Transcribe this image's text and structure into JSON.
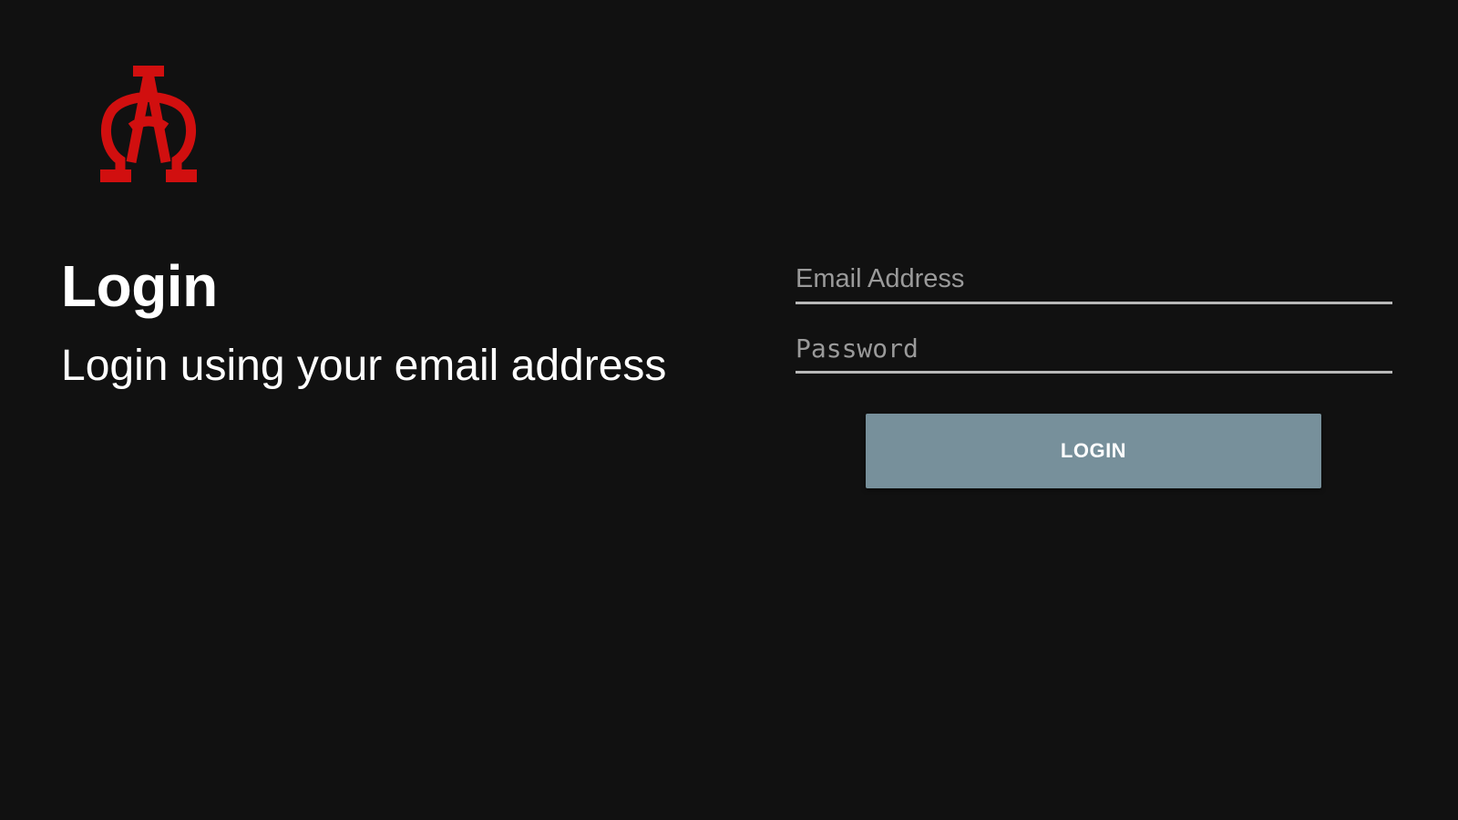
{
  "logo": {
    "icon": "alpha-omega-logo-icon",
    "color": "#d10f0f"
  },
  "header": {
    "title": "Login",
    "subtitle": "Login using your email address"
  },
  "form": {
    "email_placeholder": "Email Address",
    "email_value": "",
    "password_placeholder": "Password",
    "password_value": "",
    "login_label": "LOGIN"
  },
  "colors": {
    "background": "#111111",
    "button": "#77909b",
    "underline": "#b8b8b8"
  }
}
